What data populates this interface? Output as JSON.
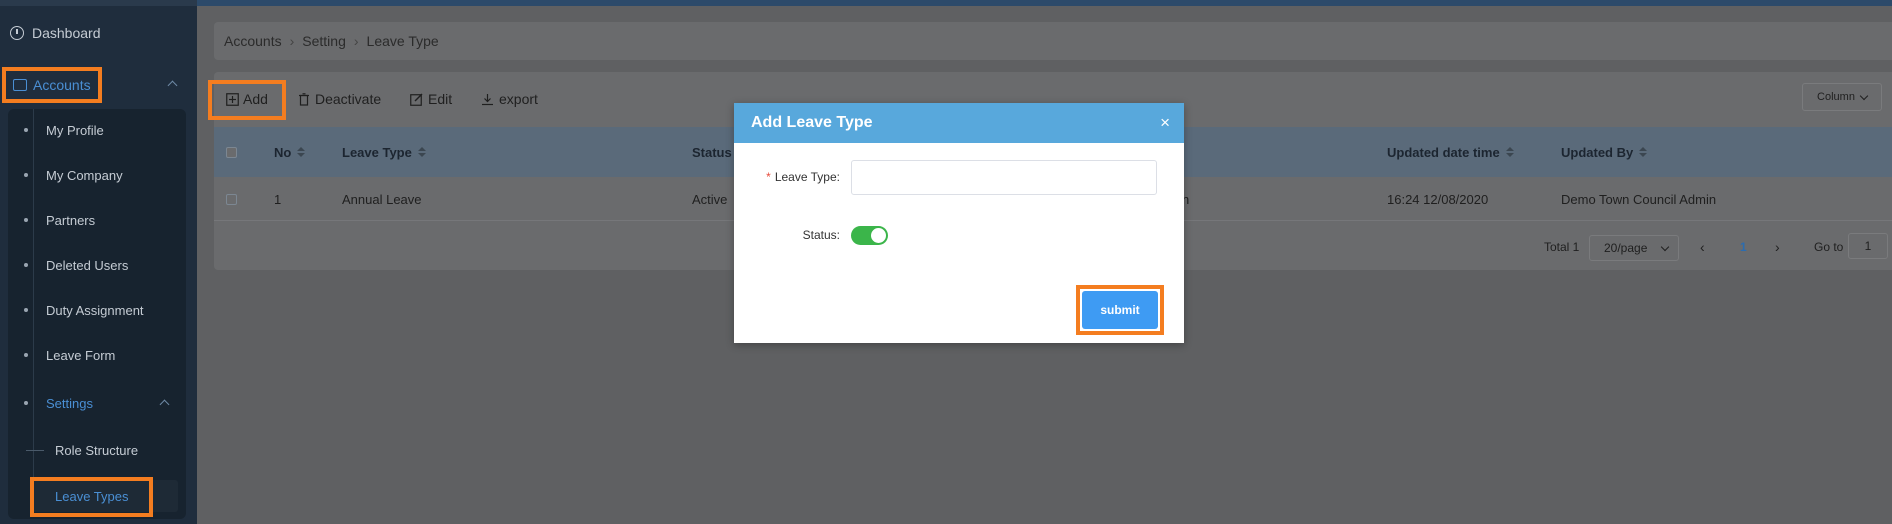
{
  "sidebar": {
    "dashboard": "Dashboard",
    "accounts": "Accounts",
    "items": [
      {
        "label": "My Profile"
      },
      {
        "label": "My Company"
      },
      {
        "label": "Partners"
      },
      {
        "label": "Deleted Users"
      },
      {
        "label": "Duty Assignment"
      },
      {
        "label": "Leave Form"
      },
      {
        "label": "Settings"
      }
    ],
    "settings_items": [
      {
        "label": "Role Structure"
      },
      {
        "label": "Leave Types"
      }
    ]
  },
  "breadcrumb": [
    "Accounts",
    "Setting",
    "Leave Type"
  ],
  "toolbar": {
    "add": "Add",
    "deactivate": "Deactivate",
    "edit": "Edit",
    "export": "export",
    "column": "Column"
  },
  "table": {
    "columns": [
      "No",
      "Leave Type",
      "Status",
      "Updated date time",
      "Updated By"
    ],
    "rows": [
      {
        "no": "1",
        "leave_type": "Annual Leave",
        "status": "Active",
        "partial": "n",
        "updated": "16:24 12/08/2020",
        "updated_by": "Demo Town Council Admin"
      }
    ]
  },
  "pagination": {
    "total": "Total 1",
    "page_size": "20/page",
    "current_page": "1",
    "goto_label": "Go to",
    "goto_value": "1"
  },
  "modal": {
    "title": "Add Leave Type",
    "close": "×",
    "leave_type_label": "Leave Type:",
    "leave_type_value": "",
    "status_label": "Status:",
    "status_on": true,
    "submit": "submit"
  },
  "colors": {
    "highlight": "#f47d20",
    "modal_header": "#58a8dc",
    "submit": "#3e9bf3",
    "switch_on": "#3bb54a",
    "accent": "#4a8fd4"
  }
}
